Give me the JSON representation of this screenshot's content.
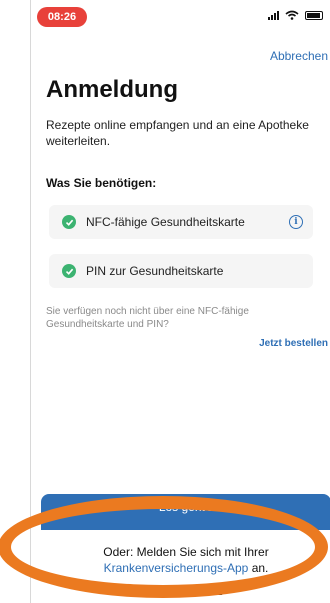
{
  "status_bar": {
    "time": "08:26"
  },
  "header": {
    "cancel_label": "Abbrechen"
  },
  "title": "Anmeldung",
  "intro": "Rezepte online empfangen und an eine Apotheke weiterleiten.",
  "requirements": {
    "heading": "Was Sie benötigen:",
    "items": [
      {
        "label": "NFC-fähige Gesundheitskarte",
        "has_info": true
      },
      {
        "label": "PIN zur Gesundheitskarte",
        "has_info": false
      }
    ]
  },
  "hint": "Sie verfügen noch nicht über eine NFC-fähige Gesundheitskarte und PIN?",
  "order_link": "Jetzt bestellen",
  "primary_button": "Los geht's",
  "alternative": {
    "prefix": "Oder: Melden Sie sich mit Ihrer",
    "link": "Krankenversicherungs-App",
    "suffix": "an."
  },
  "colors": {
    "accent": "#2f6fb5",
    "check": "#3cb371",
    "time_pill": "#e8413a",
    "annotation": "#eb7a20"
  }
}
